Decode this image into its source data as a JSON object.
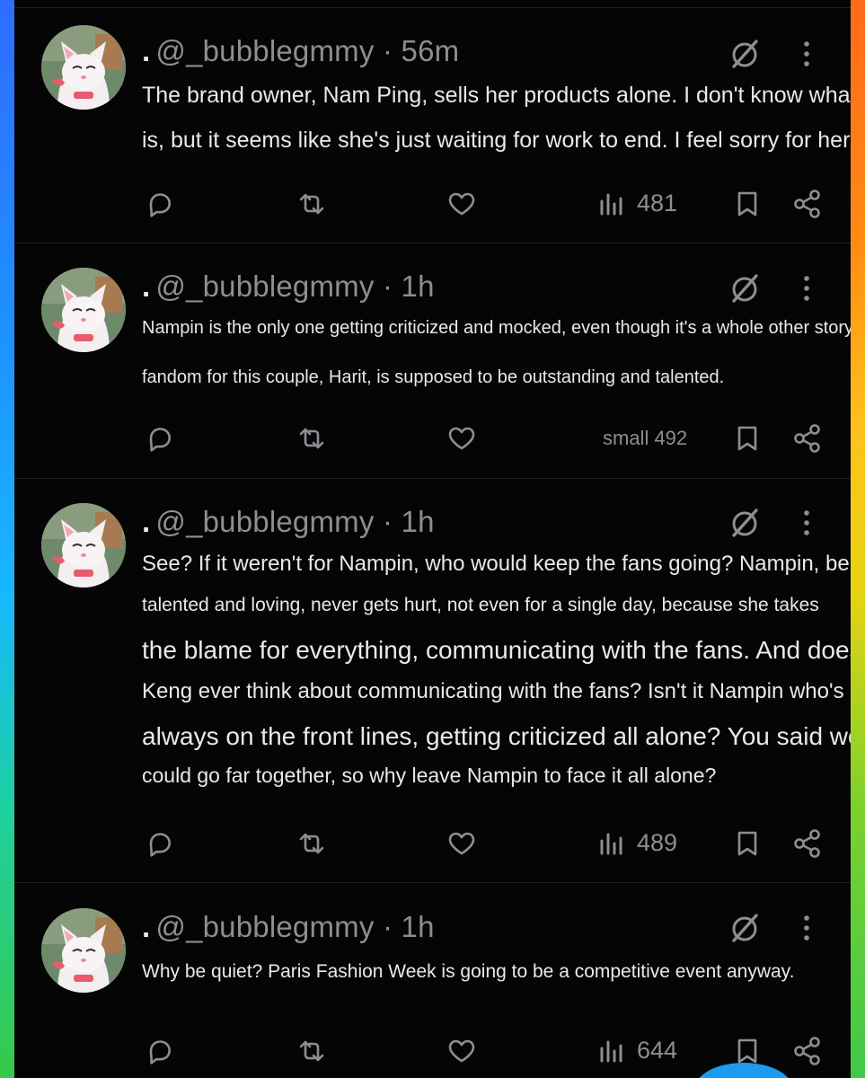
{
  "posts": [
    {
      "handle": "@_bubblegmmy",
      "separator": "·",
      "time": "56m",
      "lines": [
        "The brand owner, Nam Ping, sells her products alone. I don't know what her partner",
        "is, but it seems like she's just waiting for work to end. I feel sorry for her."
      ],
      "views": "481"
    },
    {
      "handle": "@_bubblegmmy",
      "separator": "·",
      "time": "1h",
      "lines": [
        "Nampin is the only one getting criticized and mocked, even though it's a whole other story. The",
        "fandom for this couple, Harit, is supposed to be outstanding and talented."
      ],
      "views": "small 492"
    },
    {
      "handle": "@_bubblegmmy",
      "separator": "·",
      "time": "1h",
      "lines": [
        "See? If it weren't for Nampin, who would keep the fans going? Nampin, being",
        "talented and loving, never gets hurt, not even for a single day, because she takes",
        "the blame for everything, communicating with the fans. And does",
        "Keng ever think about communicating with the fans? Isn't it Nampin who's",
        "always on the front lines, getting criticized all alone? You said we",
        "could go far together, so why leave Nampin to face it all alone?"
      ],
      "views": "489"
    },
    {
      "handle": "@_bubblegmmy",
      "separator": "·",
      "time": "1h",
      "lines": [
        "Why be quiet? Paris Fashion Week is going to be a competitive event anyway."
      ],
      "views": "644"
    }
  ],
  "icons": {
    "reply": "speech-bubble",
    "repost": "repost-arrows",
    "like": "heart",
    "views": "bar-chart",
    "bookmark": "bookmark",
    "share": "share-nodes",
    "grok": "slashed-circle",
    "more": "vertical-ellipsis"
  },
  "colors": {
    "background": "#000000",
    "text": "#e9e9e9",
    "muted": "#8b8f94",
    "divider": "#222222",
    "accent": "#1d9bf0"
  }
}
